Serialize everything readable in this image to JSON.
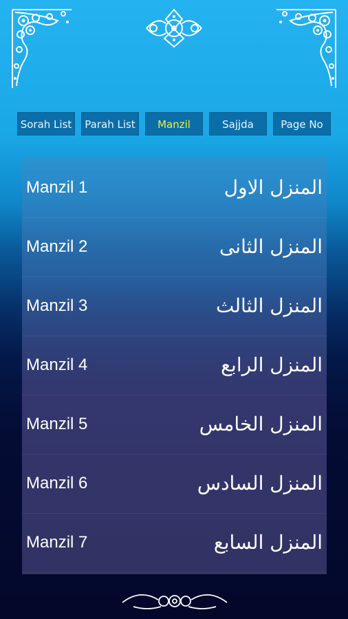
{
  "tabs": [
    {
      "label": "Sorah List",
      "active": false
    },
    {
      "label": "Parah List",
      "active": false
    },
    {
      "label": "Manzil",
      "active": true
    },
    {
      "label": "Sajjda",
      "active": false
    },
    {
      "label": "Page No",
      "active": false
    }
  ],
  "manzils": [
    {
      "en": "Manzil 1",
      "ar": "المنزل الاول"
    },
    {
      "en": "Manzil 2",
      "ar": "المنزل الثانی"
    },
    {
      "en": "Manzil 3",
      "ar": "المنزل الثالث"
    },
    {
      "en": "Manzil 4",
      "ar": "المنزل الرابع"
    },
    {
      "en": "Manzil 5",
      "ar": "المنزل الخامس"
    },
    {
      "en": "Manzil 6",
      "ar": "المنزل السادس"
    },
    {
      "en": "Manzil 7",
      "ar": "المنزل السابع"
    }
  ],
  "colors": {
    "tab_bg": "#0b6ea9",
    "tab_text": "#e8f6ff",
    "tab_active_text": "#f4f03a",
    "ornament": "#ffffff"
  }
}
